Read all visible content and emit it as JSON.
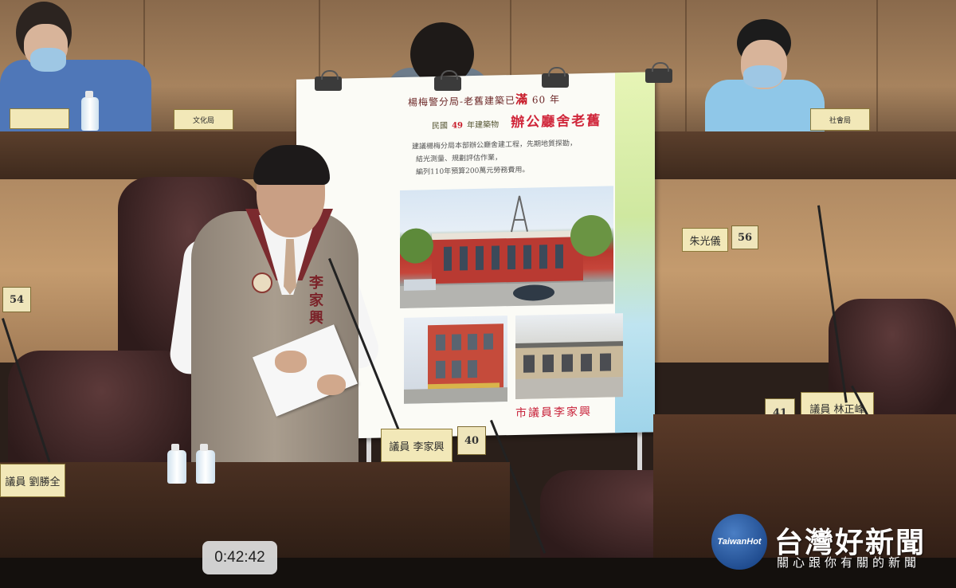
{
  "video": {
    "timestamp": "0:42:42"
  },
  "watermark": {
    "logo_mark": "TaiwanHot",
    "brand": "台灣好新聞",
    "slogan": "關心跟你有關的新聞"
  },
  "board": {
    "title_prefix": "楊梅警分局-老舊建築已",
    "title_highlight": "滿",
    "title_suffix": " 60 年",
    "subtitle_prefix": "民國",
    "subtitle_year": "49",
    "subtitle_mid": "年建築物",
    "subtitle_big": "辦公廳舍老舊",
    "lines": [
      "建議楊梅分局本部辦公廳舍建工程，先期地質探勘，",
      "結光測量、規劃評估作業，",
      "編列110年預算200萬元勞務費用。"
    ],
    "footer": "市議員李家興"
  },
  "speaker": {
    "vest_name": "李家興",
    "nameplate": "議員 李家興",
    "seat_number": "40"
  },
  "seats": [
    {
      "number": "54"
    },
    {
      "number": "56"
    },
    {
      "number": "41"
    }
  ],
  "nameplates": {
    "left": "議員 劉勝全",
    "right": "議員 林正峰",
    "back_center": "朱光儀",
    "back_left": "文化局",
    "back_right": "社會局"
  }
}
